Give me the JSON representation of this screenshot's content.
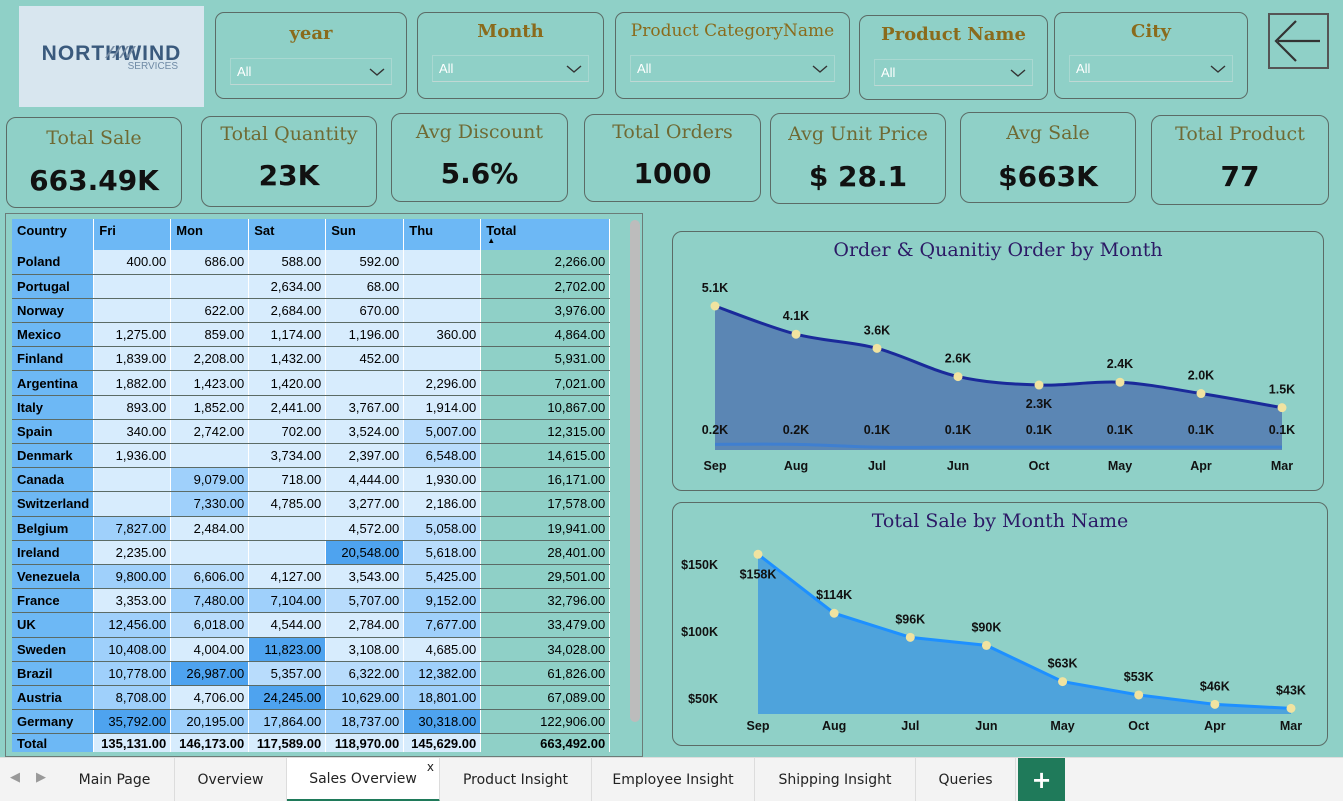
{
  "logo": {
    "brand": "NORTHWIND",
    "sub": "SERVICES"
  },
  "slicers": [
    {
      "title": "year",
      "value": "All"
    },
    {
      "title": "Month",
      "value": "All"
    },
    {
      "title": "Product CategoryName",
      "value": "All"
    },
    {
      "title": "Product Name",
      "value": "All"
    },
    {
      "title": "City",
      "value": "All"
    }
  ],
  "kpis": [
    {
      "title": "Total Sale",
      "value": "663.49K"
    },
    {
      "title": "Total Quantity",
      "value": "23K"
    },
    {
      "title": "Avg Discount",
      "value": "5.6%"
    },
    {
      "title": "Total Orders",
      "value": "1000"
    },
    {
      "title": "Avg Unit Price",
      "value": "$ 28.1"
    },
    {
      "title": "Avg Sale",
      "value": "$663K"
    },
    {
      "title": "Total Product",
      "value": "77"
    }
  ],
  "matrix": {
    "headers": [
      "Country",
      "Fri",
      "Mon",
      "Sat",
      "Sun",
      "Thu",
      "Total"
    ],
    "rows": [
      [
        "Poland",
        "400.00",
        "686.00",
        "588.00",
        "592.00",
        "",
        "2,266.00"
      ],
      [
        "Portugal",
        "",
        "",
        "2,634.00",
        "68.00",
        "",
        "2,702.00"
      ],
      [
        "Norway",
        "",
        "622.00",
        "2,684.00",
        "670.00",
        "",
        "3,976.00"
      ],
      [
        "Mexico",
        "1,275.00",
        "859.00",
        "1,174.00",
        "1,196.00",
        "360.00",
        "4,864.00"
      ],
      [
        "Finland",
        "1,839.00",
        "2,208.00",
        "1,432.00",
        "452.00",
        "",
        "5,931.00"
      ],
      [
        "Argentina",
        "1,882.00",
        "1,423.00",
        "1,420.00",
        "",
        "2,296.00",
        "7,021.00"
      ],
      [
        "Italy",
        "893.00",
        "1,852.00",
        "2,441.00",
        "3,767.00",
        "1,914.00",
        "10,867.00"
      ],
      [
        "Spain",
        "340.00",
        "2,742.00",
        "702.00",
        "3,524.00",
        "5,007.00",
        "12,315.00"
      ],
      [
        "Denmark",
        "1,936.00",
        "",
        "3,734.00",
        "2,397.00",
        "6,548.00",
        "14,615.00"
      ],
      [
        "Canada",
        "",
        "9,079.00",
        "718.00",
        "4,444.00",
        "1,930.00",
        "16,171.00"
      ],
      [
        "Switzerland",
        "",
        "7,330.00",
        "4,785.00",
        "3,277.00",
        "2,186.00",
        "17,578.00"
      ],
      [
        "Belgium",
        "7,827.00",
        "2,484.00",
        "",
        "4,572.00",
        "5,058.00",
        "19,941.00"
      ],
      [
        "Ireland",
        "2,235.00",
        "",
        "",
        "20,548.00",
        "5,618.00",
        "28,401.00"
      ],
      [
        "Venezuela",
        "9,800.00",
        "6,606.00",
        "4,127.00",
        "3,543.00",
        "5,425.00",
        "29,501.00"
      ],
      [
        "France",
        "3,353.00",
        "7,480.00",
        "7,104.00",
        "5,707.00",
        "9,152.00",
        "32,796.00"
      ],
      [
        "UK",
        "12,456.00",
        "6,018.00",
        "4,544.00",
        "2,784.00",
        "7,677.00",
        "33,479.00"
      ],
      [
        "Sweden",
        "10,408.00",
        "4,004.00",
        "11,823.00",
        "3,108.00",
        "4,685.00",
        "34,028.00"
      ],
      [
        "Brazil",
        "10,778.00",
        "26,987.00",
        "5,357.00",
        "6,322.00",
        "12,382.00",
        "61,826.00"
      ],
      [
        "Austria",
        "8,708.00",
        "4,706.00",
        "24,245.00",
        "10,629.00",
        "18,801.00",
        "67,089.00"
      ],
      [
        "Germany",
        "35,792.00",
        "20,195.00",
        "17,864.00",
        "18,737.00",
        "30,318.00",
        "122,906.00"
      ]
    ],
    "total_row": [
      "Total",
      "135,131.00",
      "146,173.00",
      "117,589.00",
      "118,970.00",
      "145,629.00",
      "663,492.00"
    ]
  },
  "chart_data": [
    {
      "type": "area",
      "title": "Order & Quanitiy Order by Month",
      "categories": [
        "Sep",
        "Aug",
        "Jul",
        "Jun",
        "Oct",
        "May",
        "Apr",
        "Mar"
      ],
      "series": [
        {
          "values": [
            5.1,
            4.1,
            3.6,
            2.6,
            2.3,
            2.4,
            2.0,
            1.5
          ],
          "labels": [
            "5.1K",
            "4.1K",
            "3.6K",
            "2.6K",
            "2.3K",
            "2.4K",
            "2.0K",
            "1.5K"
          ],
          "color": "#1a2a9a"
        },
        {
          "values": [
            0.2,
            0.2,
            0.1,
            0.1,
            0.1,
            0.1,
            0.1,
            0.1
          ],
          "labels": [
            "0.2K",
            "0.2K",
            "0.1K",
            "0.1K",
            "0.1K",
            "0.1K",
            "0.1K",
            "0.1K"
          ],
          "color": "#3f7fd0"
        }
      ],
      "ylim": [
        0,
        5.1
      ]
    },
    {
      "type": "area",
      "title": "Total Sale by Month Name",
      "categories": [
        "Sep",
        "Aug",
        "Jul",
        "Jun",
        "May",
        "Oct",
        "Apr",
        "Mar"
      ],
      "series": [
        {
          "values": [
            158,
            114,
            96,
            90,
            63,
            53,
            46,
            43
          ],
          "labels": [
            "$158K",
            "$114K",
            "$96K",
            "$90K",
            "$63K",
            "$53K",
            "$46K",
            "$43K"
          ],
          "color": "#1e90ff"
        }
      ],
      "yticks": [
        "$150K",
        "$100K",
        "$50K"
      ],
      "ytick_values": [
        150,
        100,
        50
      ]
    }
  ],
  "tabs": [
    "Main Page",
    "Overview",
    "Sales Overview",
    "Product Insight",
    "Employee Insight",
    "Shipping Insight",
    "Queries"
  ],
  "active_tab": "Sales Overview",
  "add_tab": "+",
  "tab_close": "x"
}
